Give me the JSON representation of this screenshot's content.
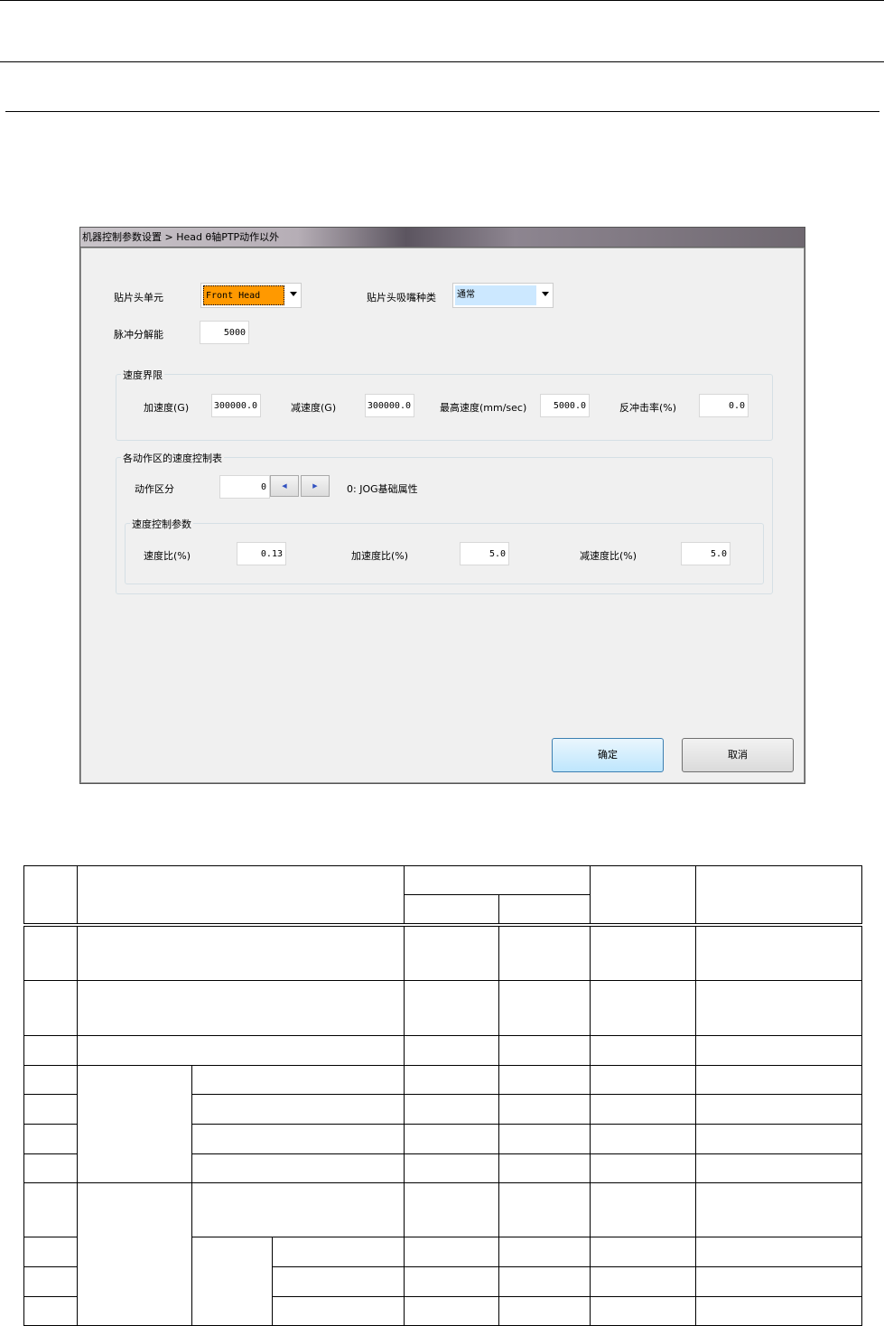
{
  "dialog": {
    "title": "机器控制参数设置 > Head θ轴PTP动作以外",
    "head_unit_label": "贴片头单元",
    "head_unit_value": "Front Head",
    "nozzle_type_label": "贴片头吸嘴种类",
    "nozzle_type_value": "通常",
    "pulse_label": "脉冲分解能",
    "pulse_value": "5000",
    "speed_limit": {
      "title": "速度界限",
      "accel_label": "加速度(G)",
      "accel_value": "300000.0",
      "decel_label": "减速度(G)",
      "decel_value": "300000.0",
      "max_speed_label": "最高速度(mm/sec)",
      "max_speed_value": "5000.0",
      "recoil_label": "反冲击率(%)",
      "recoil_value": "0.0"
    },
    "zone_table": {
      "title": "各动作区的速度控制表",
      "zone_label": "动作区分",
      "zone_value": "0",
      "prev_icon": "triangle-left",
      "next_icon": "triangle-right",
      "zone_desc": "0: JOG基础属性",
      "params": {
        "title": "速度控制参数",
        "speed_ratio_label": "速度比(%)",
        "speed_ratio_value": "0.13",
        "accel_ratio_label": "加速度比(%)",
        "accel_ratio_value": "5.0",
        "decel_ratio_label": "减速度比(%)",
        "decel_ratio_value": "5.0"
      }
    },
    "ok_label": "确定",
    "cancel_label": "取消",
    "colors": {
      "head_unit_highlight": "#ff9900",
      "nozzle_highlight": "#cce8ff"
    }
  }
}
